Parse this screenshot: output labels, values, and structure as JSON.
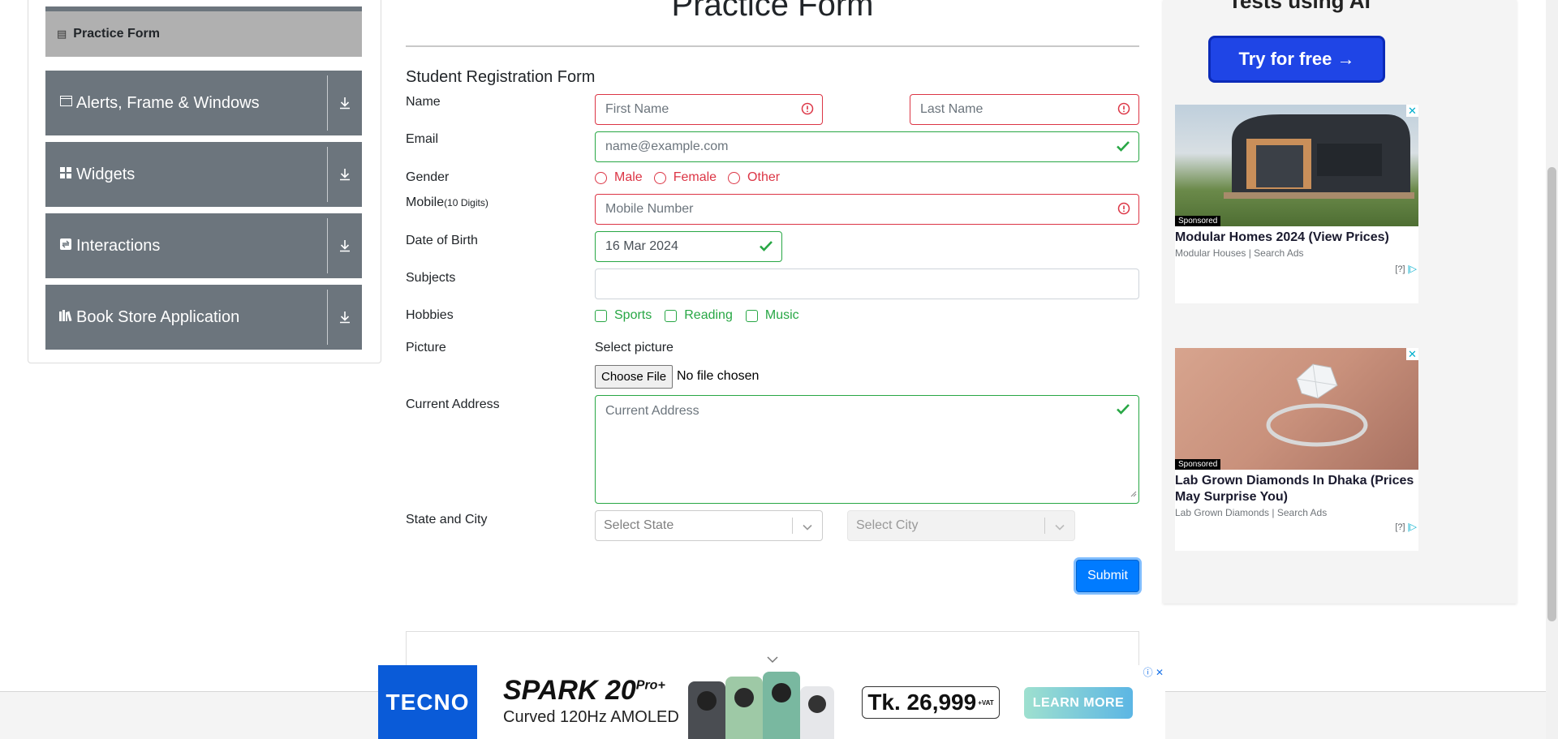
{
  "sidebar": {
    "active_item": {
      "label": "Practice Form",
      "icon": "form-icon"
    },
    "groups": [
      {
        "label": "Alerts, Frame & Windows",
        "icon": "window-icon"
      },
      {
        "label": "Widgets",
        "icon": "widgets-icon"
      },
      {
        "label": "Interactions",
        "icon": "interactions-icon"
      },
      {
        "label": "Book Store Application",
        "icon": "books-icon"
      }
    ]
  },
  "form": {
    "title": "Practice Form",
    "subtitle": "Student Registration Form",
    "labels": {
      "name": "Name",
      "email": "Email",
      "gender": "Gender",
      "mobile": "Mobile",
      "mobile_hint": "(10 Digits)",
      "dob": "Date of Birth",
      "subjects": "Subjects",
      "hobbies": "Hobbies",
      "picture": "Picture",
      "address": "Current Address",
      "state_city": "State and City"
    },
    "placeholders": {
      "first_name": "First Name",
      "last_name": "Last Name",
      "email": "name@example.com",
      "mobile": "Mobile Number",
      "address": "Current Address",
      "state": "Select State",
      "city": "Select City"
    },
    "dob_value": "16 Mar 2024",
    "gender_options": [
      "Male",
      "Female",
      "Other"
    ],
    "hobby_options": [
      "Sports",
      "Reading",
      "Music"
    ],
    "picture_select_label": "Select picture",
    "file_button": "Choose File",
    "file_status": "No file chosen",
    "submit": "Submit"
  },
  "ads": {
    "cta_text": "Tests using AI",
    "cta_button": "Try for free →",
    "cards": [
      {
        "sponsored": "Sponsored",
        "headline": "Modular Homes 2024 (View Prices)",
        "source": "Modular Houses | Search Ads",
        "choice": "[?]"
      },
      {
        "sponsored": "Sponsored",
        "headline": "Lab Grown Diamonds In Dhaka (Prices May Surprise You)",
        "source": "Lab Grown Diamonds | Search Ads",
        "choice": "[?]"
      }
    ],
    "banner": {
      "brand": "TECNO",
      "product": "SPARK 20",
      "product_suffix": "Pro+",
      "tagline": "Curved 120Hz AMOLED",
      "price": "Tk. 26,999",
      "price_note": "+VAT",
      "cta": "LEARN MORE"
    }
  },
  "colors": {
    "invalid": "#dc3545",
    "valid": "#28a745",
    "primary": "#007bff",
    "sidebar_group": "#6c757d"
  }
}
